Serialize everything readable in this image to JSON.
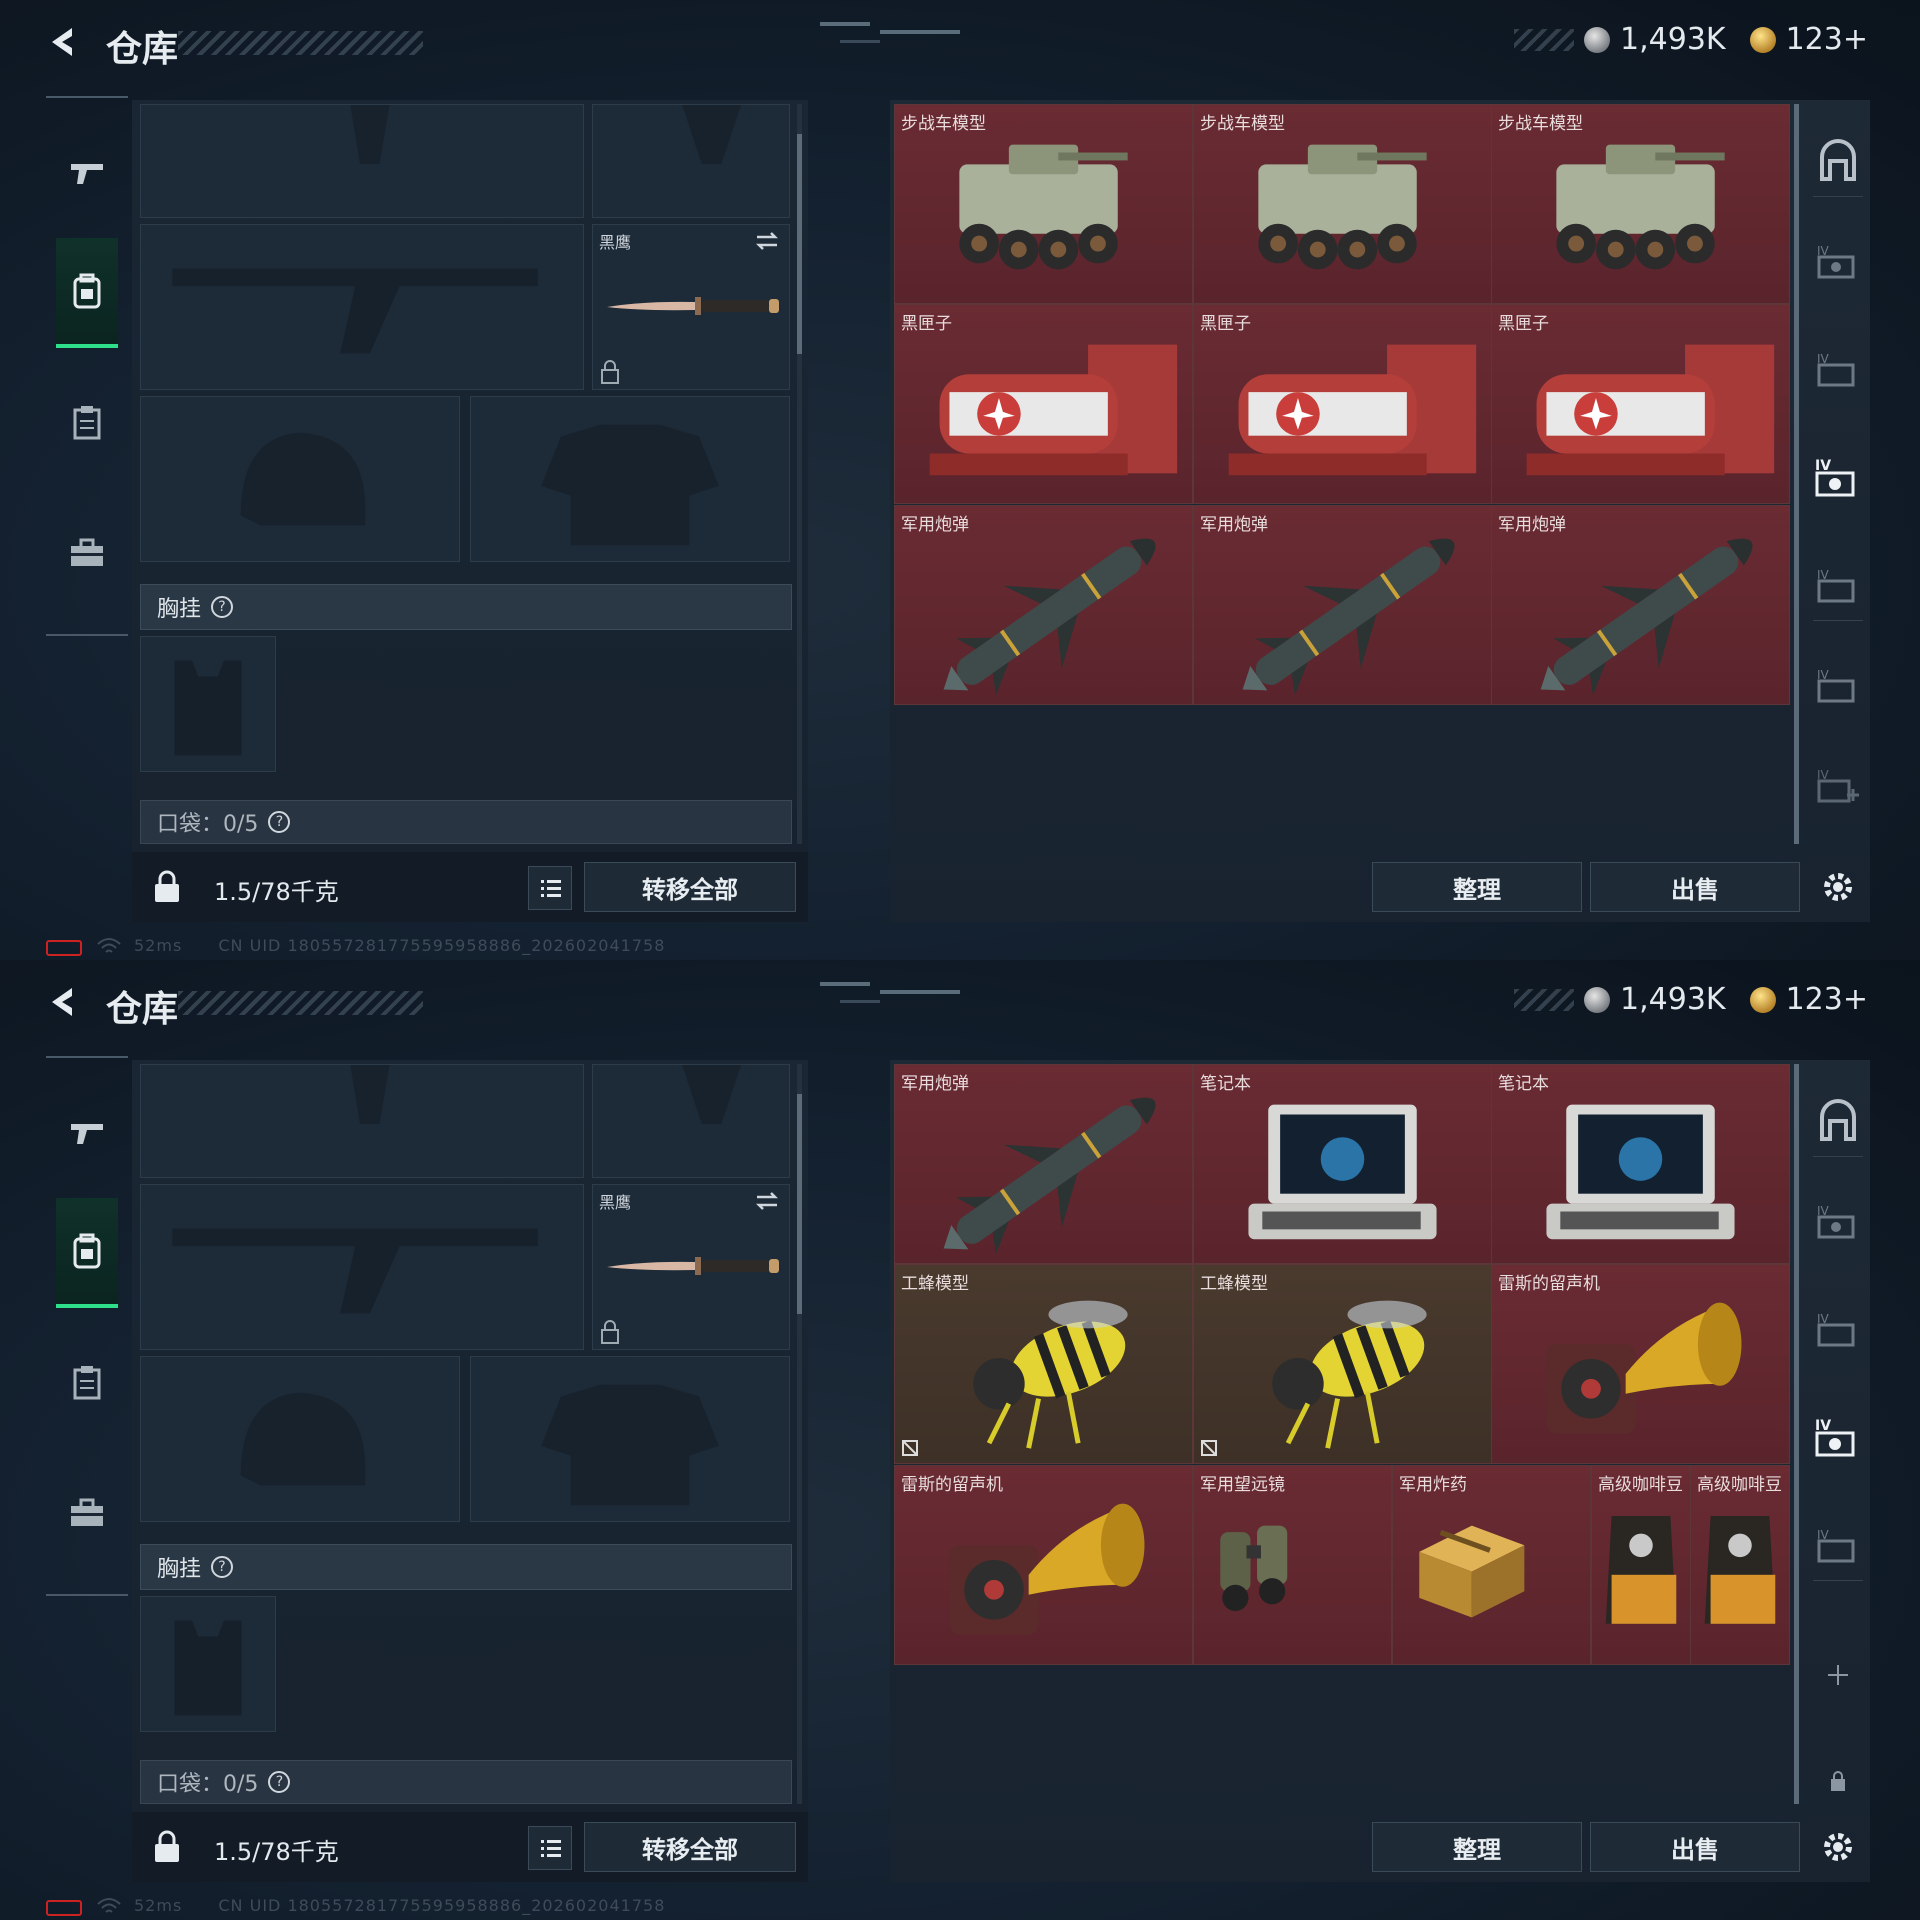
{
  "screens": [
    {
      "header": {
        "title": "仓库"
      },
      "currency": {
        "silver": "1,493K",
        "gold": "123+"
      },
      "sidebar": {
        "items": [
          "gun",
          "backpack",
          "clipboard",
          "toolbox"
        ],
        "active": 1
      },
      "loadout": {
        "knife_name": "黑鹰",
        "chest_rig_label": "胸挂",
        "pocket_label": "口袋：0/5",
        "weight": "1.5/78千克",
        "transfer_all": "转移全部"
      },
      "grid": [
        {
          "name": "步战车模型",
          "icon": "ifv-model",
          "bg": "red"
        },
        {
          "name": "步战车模型",
          "icon": "ifv-model",
          "bg": "red"
        },
        {
          "name": "步战车模型",
          "icon": "ifv-model",
          "bg": "red"
        },
        {
          "name": "黑匣子",
          "icon": "black-box",
          "bg": "red"
        },
        {
          "name": "黑匣子",
          "icon": "black-box",
          "bg": "red"
        },
        {
          "name": "黑匣子",
          "icon": "black-box",
          "bg": "red"
        },
        {
          "name": "军用炮弹",
          "icon": "military-shell",
          "bg": "red"
        },
        {
          "name": "军用炮弹",
          "icon": "military-shell",
          "bg": "red"
        },
        {
          "name": "军用炮弹",
          "icon": "military-shell",
          "bg": "red"
        }
      ],
      "actions": {
        "sort": "整理",
        "sell": "出售"
      },
      "status": {
        "signal": "52ms",
        "uid": "CN UID 180557281775595958886_202602041758"
      }
    },
    {
      "header": {
        "title": "仓库"
      },
      "currency": {
        "silver": "1,493K",
        "gold": "123+"
      },
      "sidebar": {
        "items": [
          "gun",
          "backpack",
          "clipboard",
          "toolbox"
        ],
        "active": 1
      },
      "loadout": {
        "knife_name": "黑鹰",
        "chest_rig_label": "胸挂",
        "pocket_label": "口袋：0/5",
        "weight": "1.5/78千克",
        "transfer_all": "转移全部"
      },
      "grid": [
        {
          "name": "军用炮弹",
          "icon": "military-shell",
          "bg": "red"
        },
        {
          "name": "笔记本",
          "icon": "laptop",
          "bg": "red"
        },
        {
          "name": "笔记本",
          "icon": "laptop",
          "bg": "red"
        },
        {
          "name": "工蜂模型",
          "icon": "worker-bee-model",
          "bg": "brown",
          "no_effect": true
        },
        {
          "name": "工蜂模型",
          "icon": "worker-bee-model",
          "bg": "brown",
          "no_effect": true
        },
        {
          "name": "雷斯的留声机",
          "icon": "phonograph",
          "bg": "red"
        },
        {
          "name": "雷斯的留声机",
          "icon": "phonograph",
          "bg": "red"
        },
        {
          "name": "军用望远镜",
          "icon": "binoculars",
          "bg": "red"
        },
        {
          "name": "军用炸药",
          "icon": "explosives-crate",
          "bg": "red"
        },
        {
          "name": "高级咖啡豆",
          "icon": "coffee-beans",
          "bg": "red"
        },
        {
          "name": "高级咖啡豆",
          "icon": "coffee-beans",
          "bg": "red"
        }
      ],
      "actions": {
        "sort": "整理",
        "sell": "出售"
      },
      "status": {
        "signal": "52ms",
        "uid": "CN UID 180557281775595958886_202602041758"
      }
    }
  ],
  "colors": {
    "accent_green": "#2ee08a",
    "item_red": "#6a2b33",
    "item_brown": "#4a3a2e"
  }
}
